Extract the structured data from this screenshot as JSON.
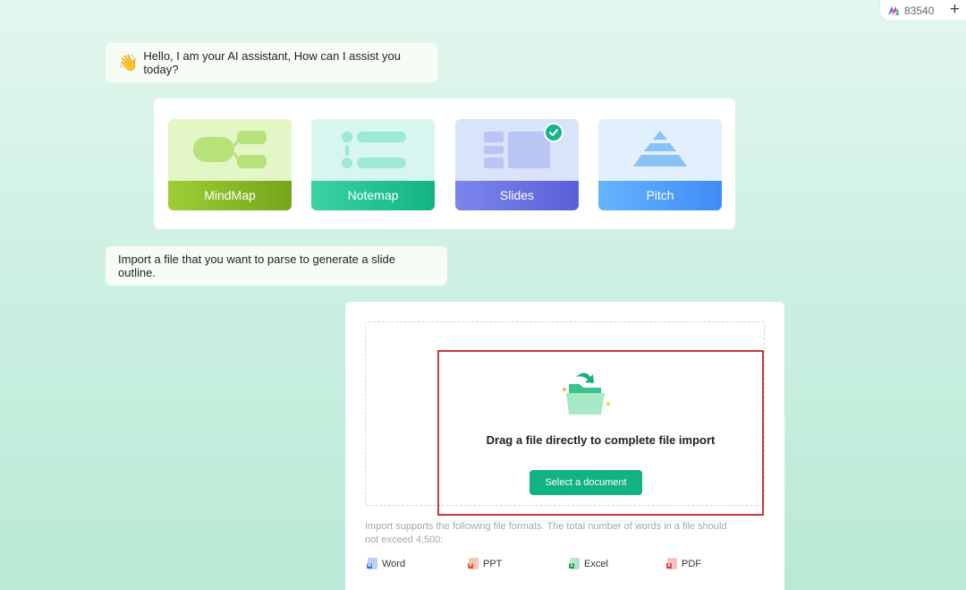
{
  "header": {
    "credits_count": "83540",
    "add_symbol": "+"
  },
  "chat": {
    "greeting": "Hello, I am your AI assistant, How can I assist you today?",
    "import_prompt": "Import a file that you want to parse to generate a slide outline."
  },
  "modes": [
    {
      "label": "MindMap",
      "icon": "mindmap-icon"
    },
    {
      "label": "Notemap",
      "icon": "notemap-icon"
    },
    {
      "label": "Slides",
      "icon": "slides-icon",
      "selected": true
    },
    {
      "label": "Pitch",
      "icon": "pyramid-icon"
    }
  ],
  "import": {
    "drag_title": "Drag a file directly to complete file import",
    "select_button": "Select a document",
    "note": "Import supports the following file formats. The total number of words in a file should not exceed 4,500:",
    "formats": [
      {
        "label": "Word",
        "icon": "word-file-icon"
      },
      {
        "label": "PPT",
        "icon": "ppt-file-icon"
      },
      {
        "label": "Excel",
        "icon": "excel-file-icon"
      },
      {
        "label": "PDF",
        "icon": "pdf-file-icon"
      }
    ]
  },
  "colors": {
    "accent_green": "#12b383",
    "highlight_red": "#c53a3a",
    "mindmap": "#8ab82a",
    "notemap": "#25c493",
    "slides": "#6a72e2",
    "pitch": "#4b9cf7"
  }
}
